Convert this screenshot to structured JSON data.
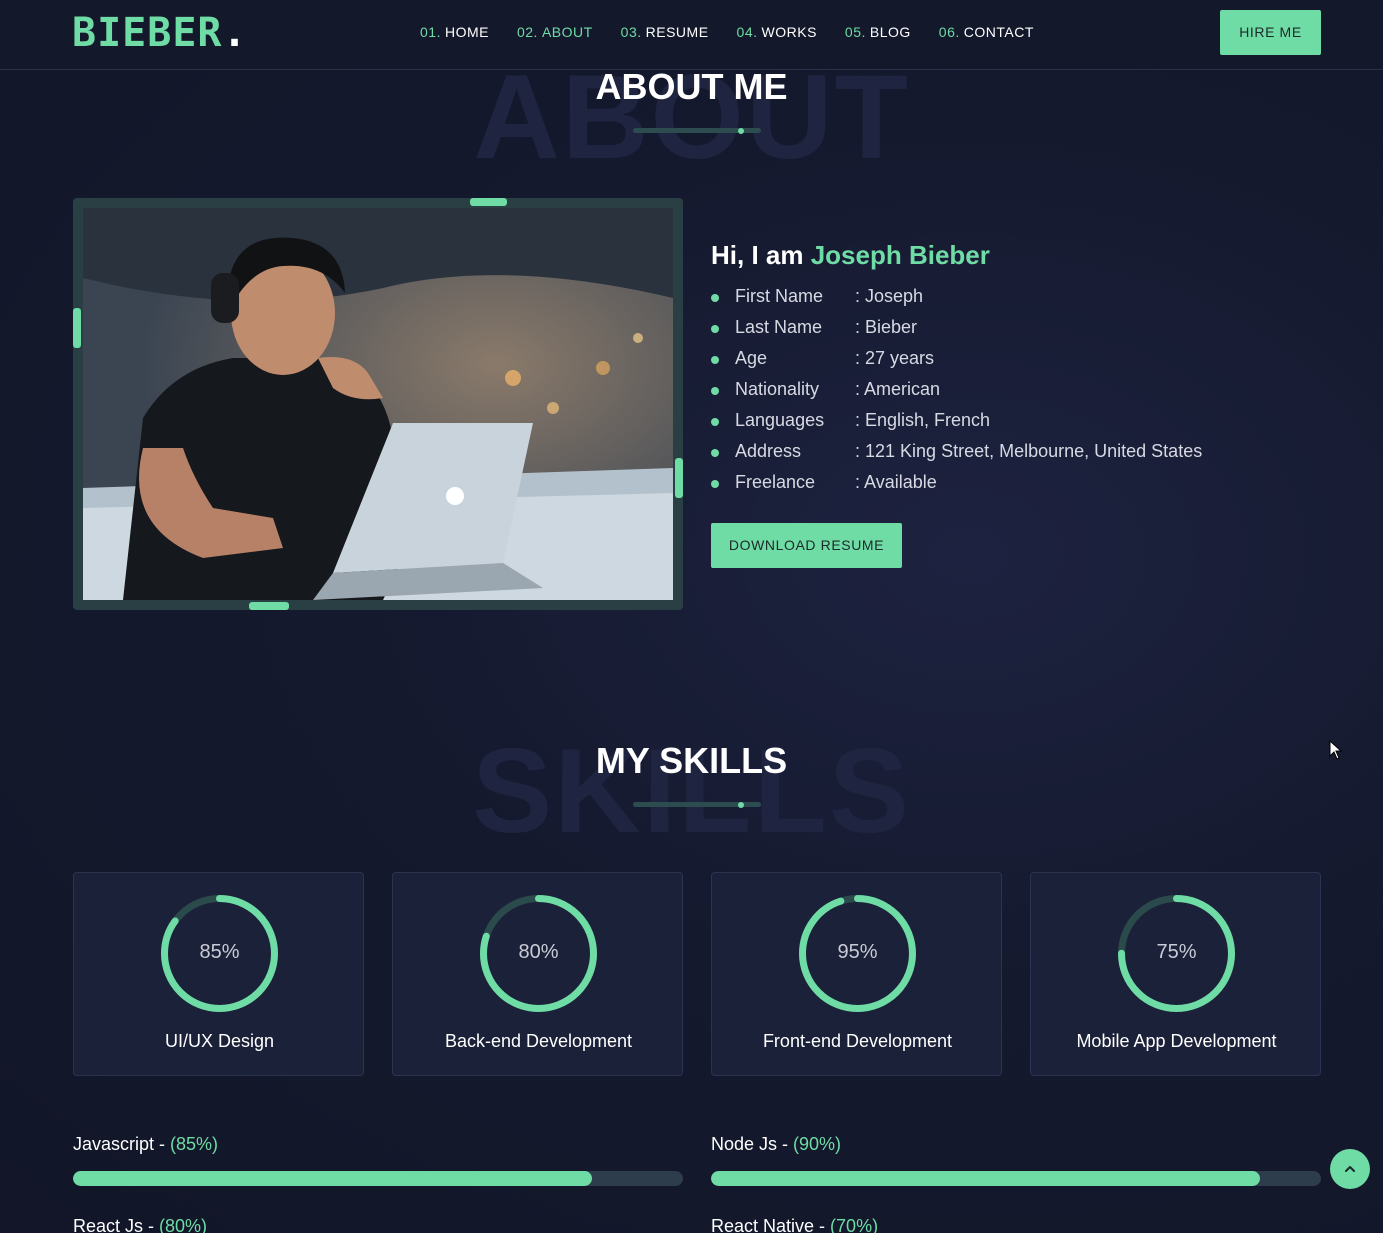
{
  "nav": {
    "logo": "BIEBER",
    "logo_dot": ".",
    "items": [
      {
        "num": "01.",
        "label": "HOME",
        "active": false
      },
      {
        "num": "02.",
        "label": "ABOUT",
        "active": true
      },
      {
        "num": "03.",
        "label": "RESUME",
        "active": false
      },
      {
        "num": "04.",
        "label": "WORKS",
        "active": false
      },
      {
        "num": "05.",
        "label": "BLOG",
        "active": false
      },
      {
        "num": "06.",
        "label": "CONTACT",
        "active": false
      }
    ],
    "hire_label": "HIRE ME"
  },
  "about": {
    "bg_word": "ABOUT",
    "title": "ABOUT ME",
    "greeting": "Hi, I am",
    "name": "Joseph Bieber",
    "info": [
      {
        "label": "First Name",
        "value": ": Joseph"
      },
      {
        "label": "Last Name",
        "value": ": Bieber"
      },
      {
        "label": "Age",
        "value": ": 27 years"
      },
      {
        "label": "Nationality",
        "value": ": American"
      },
      {
        "label": "Languages",
        "value": ": English, French"
      },
      {
        "label": "Address",
        "value": ": 121 King Street, Melbourne, United States"
      },
      {
        "label": "Freelance",
        "value": ": Available"
      }
    ],
    "download_label": "DOWNLOAD RESUME"
  },
  "skills": {
    "bg_word": "SKILLS",
    "title": "MY SKILLS",
    "cards": [
      {
        "pct_text": "85%",
        "value": 0.85,
        "label": "UI/UX Design"
      },
      {
        "pct_text": "80%",
        "value": 0.8,
        "label": "Back-end Development"
      },
      {
        "pct_text": "95%",
        "value": 0.95,
        "label": "Front-end Development"
      },
      {
        "pct_text": "75%",
        "value": 0.75,
        "label": "Mobile App Development"
      }
    ],
    "bars": [
      {
        "name": "Javascript - ",
        "pct_text": "(85%)",
        "value": 0.85
      },
      {
        "name": "Node Js - ",
        "pct_text": "(90%)",
        "value": 0.9
      },
      {
        "name": "React Js - ",
        "pct_text": "(80%)",
        "value": 0.8
      },
      {
        "name": "React Native - ",
        "pct_text": "(70%)",
        "value": 0.7
      }
    ]
  },
  "colors": {
    "accent": "#6fdba5",
    "background": "#14182b",
    "card": "#1b2138"
  },
  "icons": {
    "scroll_top": "chevron-up-icon",
    "cursor": "mouse-cursor-icon"
  }
}
